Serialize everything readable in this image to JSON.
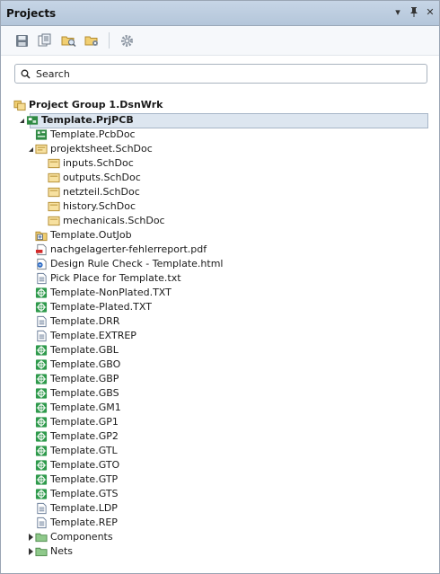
{
  "panel": {
    "title": "Projects"
  },
  "search": {
    "placeholder": "Search"
  },
  "tree": {
    "group": "Project Group 1.DsnWrk",
    "project": "Template.PrjPCB",
    "pcbdoc": "Template.PcbDoc",
    "sheet": "projektsheet.SchDoc",
    "children": [
      "inputs.SchDoc",
      "outputs.SchDoc",
      "netzteil.SchDoc",
      "history.SchDoc",
      "mechanicals.SchDoc"
    ],
    "outjob": "Template.OutJob",
    "pdf": "nachgelagerter-fehlerreport.pdf",
    "html": "Design Rule Check - Template.html",
    "pickplace": "Pick Place for Template.txt",
    "files": [
      {
        "label": "Template-NonPlated.TXT",
        "icon": "gerber"
      },
      {
        "label": "Template-Plated.TXT",
        "icon": "gerber"
      },
      {
        "label": "Template.DRR",
        "icon": "text"
      },
      {
        "label": "Template.EXTREP",
        "icon": "text"
      },
      {
        "label": "Template.GBL",
        "icon": "gerber"
      },
      {
        "label": "Template.GBO",
        "icon": "gerber"
      },
      {
        "label": "Template.GBP",
        "icon": "gerber"
      },
      {
        "label": "Template.GBS",
        "icon": "gerber"
      },
      {
        "label": "Template.GM1",
        "icon": "gerber"
      },
      {
        "label": "Template.GP1",
        "icon": "gerber"
      },
      {
        "label": "Template.GP2",
        "icon": "gerber"
      },
      {
        "label": "Template.GTL",
        "icon": "gerber"
      },
      {
        "label": "Template.GTO",
        "icon": "gerber"
      },
      {
        "label": "Template.GTP",
        "icon": "gerber"
      },
      {
        "label": "Template.GTS",
        "icon": "gerber"
      },
      {
        "label": "Template.LDP",
        "icon": "text"
      },
      {
        "label": "Template.REP",
        "icon": "text"
      }
    ],
    "components": "Components",
    "nets": "Nets"
  },
  "colors": {
    "accent": "#2f9a4c",
    "folder": "#f3d27a",
    "titlebar": "#b9cadd",
    "selection": "#dde6f0"
  }
}
